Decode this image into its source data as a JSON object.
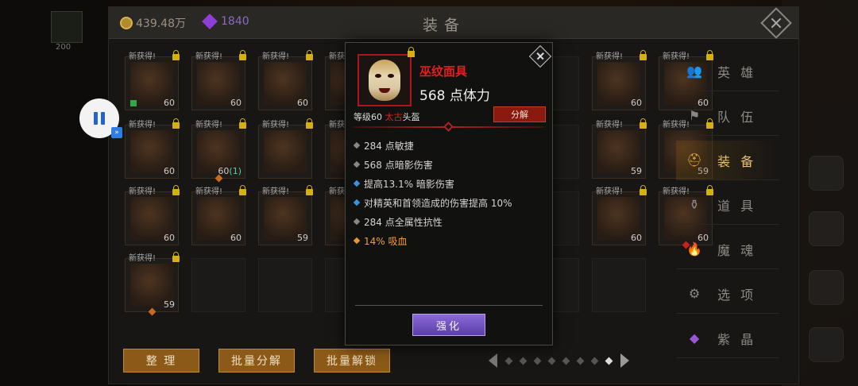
{
  "header": {
    "gold_amount": "439.48万",
    "gem_amount": "1840",
    "title": "装备",
    "char_level": "200"
  },
  "grid": {
    "new_label": "新获得!",
    "slots": [
      {
        "row": 0,
        "col": 0,
        "new": true,
        "level": "60"
      },
      {
        "row": 0,
        "col": 1,
        "new": true,
        "level": "60"
      },
      {
        "row": 0,
        "col": 2,
        "new": true,
        "level": "60"
      },
      {
        "row": 0,
        "col": 3,
        "new": true,
        "level": ""
      },
      {
        "row": 0,
        "col": 7,
        "new": true,
        "level": "60"
      },
      {
        "row": 0,
        "col": 8,
        "new": true,
        "level": "60"
      },
      {
        "row": 1,
        "col": 0,
        "new": true,
        "level": "60"
      },
      {
        "row": 1,
        "col": 1,
        "new": true,
        "level": "60",
        "sub": "(1)"
      },
      {
        "row": 1,
        "col": 2,
        "new": true,
        "level": ""
      },
      {
        "row": 1,
        "col": 3,
        "new": true,
        "level": ""
      },
      {
        "row": 1,
        "col": 7,
        "new": true,
        "level": "59"
      },
      {
        "row": 1,
        "col": 8,
        "new": true,
        "level": "59"
      },
      {
        "row": 2,
        "col": 0,
        "new": true,
        "level": "60"
      },
      {
        "row": 2,
        "col": 1,
        "new": true,
        "level": "60"
      },
      {
        "row": 2,
        "col": 2,
        "new": true,
        "level": "59"
      },
      {
        "row": 2,
        "col": 3,
        "new": true,
        "level": ""
      },
      {
        "row": 2,
        "col": 7,
        "new": true,
        "level": "60"
      },
      {
        "row": 2,
        "col": 8,
        "new": true,
        "level": "60"
      },
      {
        "row": 3,
        "col": 0,
        "new": true,
        "level": "59"
      }
    ]
  },
  "bottom": {
    "sort_label": "整 理",
    "batch_salvage_label": "批量分解",
    "batch_unlock_label": "批量解锁",
    "pages": 8,
    "current_page": 8
  },
  "menu": {
    "items": [
      {
        "label": "英 雄",
        "icon": "heroes-icon"
      },
      {
        "label": "队 伍",
        "icon": "flag-icon"
      },
      {
        "label": "装 备",
        "icon": "helmet-icon",
        "active": true
      },
      {
        "label": "道 具",
        "icon": "bag-icon"
      },
      {
        "label": "魔 魂",
        "icon": "fire-icon"
      },
      {
        "label": "选 项",
        "icon": "gear-icon"
      },
      {
        "label": "紫 晶",
        "icon": "crystal-icon"
      }
    ]
  },
  "popup": {
    "item_name": "巫纹面具",
    "main_stat": "568 点体力",
    "level_prefix": "等级60 ",
    "tier": "太古",
    "slot_type": "头盔",
    "salvage_label": "分解",
    "enhance_label": "强化",
    "stats": [
      {
        "text": "284 点敏捷",
        "kind": "grey"
      },
      {
        "text": "568 点暗影伤害",
        "kind": "grey"
      },
      {
        "text": "提高13.1% 暗影伤害",
        "kind": "blue"
      },
      {
        "text": "对精英和首领造成的伤害提高 10%",
        "kind": "blue"
      },
      {
        "text": "284 点全属性抗性",
        "kind": "grey"
      },
      {
        "text": "14% 吸血",
        "kind": "orange"
      }
    ]
  },
  "colors": {
    "legendary_red": "#e02020",
    "lifesteal_orange": "#f0a02c",
    "affix_blue": "#3d8fe0",
    "active_menu_gold": "#e9c06a"
  }
}
